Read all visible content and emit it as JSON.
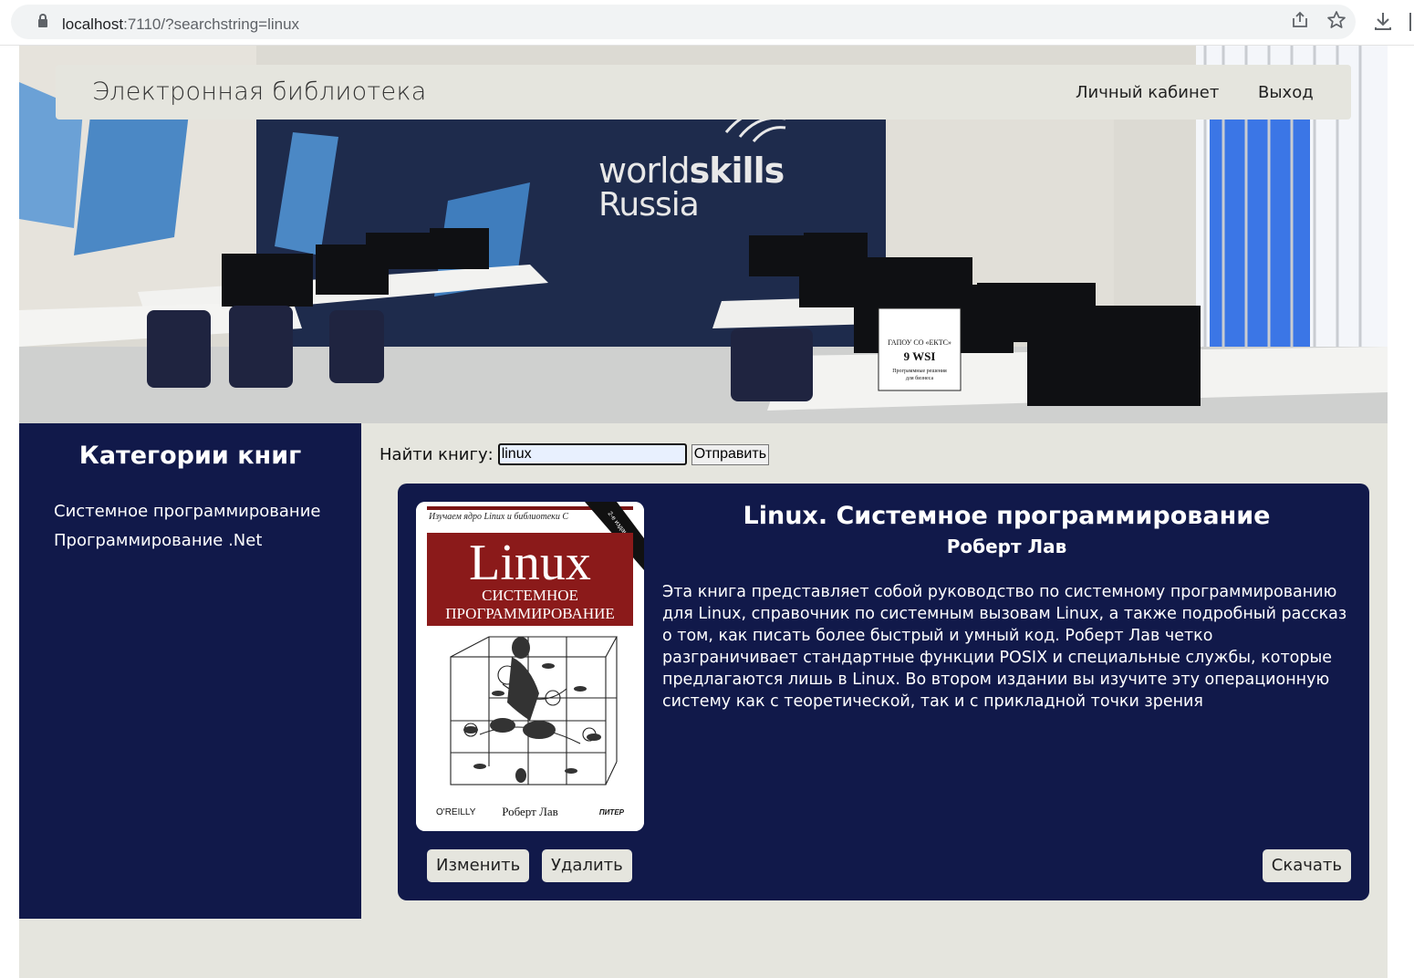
{
  "browser": {
    "url_host": "localhost",
    "url_path": ":7110/?searchstring=linux"
  },
  "navbar": {
    "brand": "Электронная библиотека",
    "links": [
      "Личный кабинет",
      "Выход"
    ]
  },
  "hero": {
    "logo_line1_light": "world",
    "logo_line1_bold": "skills",
    "logo_line2": "Russia",
    "sign_lines": [
      "ГАПОУ СО «ЕКТС»",
      "9 WSI",
      "Программные решения",
      "для бизнеса"
    ]
  },
  "sidebar": {
    "title": "Категории книг",
    "categories": [
      "Системное программирование",
      "Программирование .Net"
    ]
  },
  "search": {
    "label": "Найти книгу:",
    "value": "linux",
    "submit_label": "Отправить"
  },
  "book": {
    "title": "Linux. Системное программирование",
    "author": "Роберт Лав",
    "description": "Эта книга представляет собой руководство по системному программированию для Linux, справочник по системным вызовам Linux, а также подробный рассказ о том, как писать более быстрый и умный код. Роберт Лав четко разграничивает стандартные функции POSIX и специальные службы, которые предлагаются лишь в Linux. Во втором издании вы изучите эту операционную систему как с теоретической, так и с прикладной точки зрения",
    "cover": {
      "top_text": "Изучаем ядро Linux и библиотеки С",
      "edition_ribbon": "2-е издание",
      "big_title": "Linux",
      "subtitle_1": "СИСТЕМНОЕ",
      "subtitle_2": "ПРОГРАММИРОВАНИЕ",
      "publisher_left": "O'REILLY",
      "author": "Роберт Лав",
      "publisher_right": "ПИТЕР"
    },
    "buttons": {
      "edit": "Изменить",
      "delete": "Удалить",
      "download": "Скачать"
    }
  },
  "colors": {
    "dark_blue": "#11194a",
    "page_bg": "#e5e5de",
    "cover_red": "#8b1a1a"
  }
}
